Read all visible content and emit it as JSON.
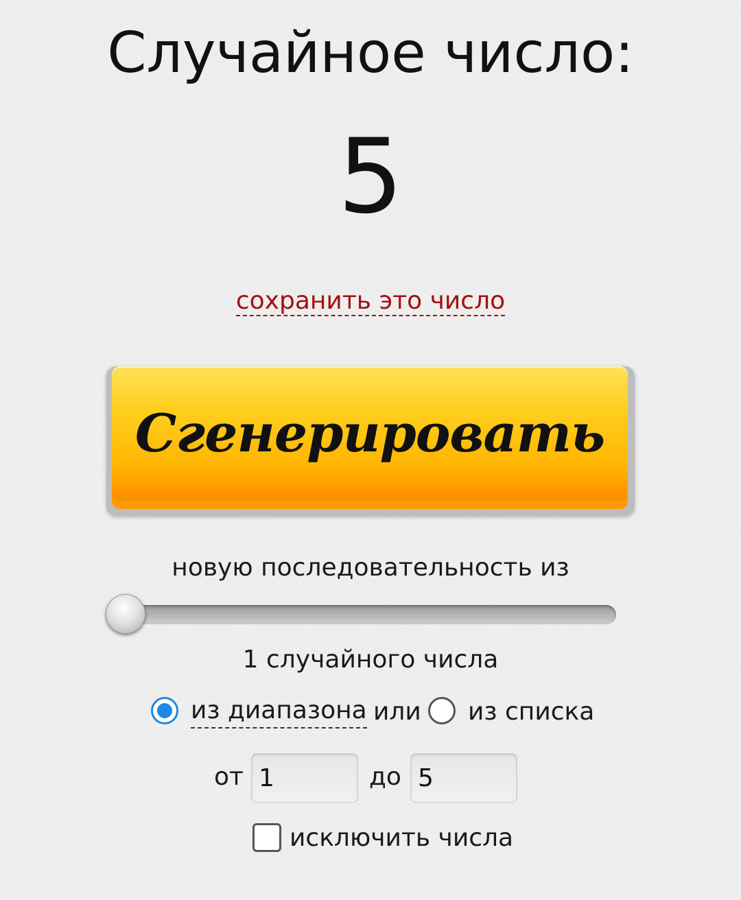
{
  "header": {
    "title": "Случайное число:"
  },
  "result": {
    "value": "5"
  },
  "save_link": {
    "label": "сохранить это число"
  },
  "generate_button": {
    "label": "Сгенерировать"
  },
  "sequence": {
    "label": "новую последовательность из",
    "slider_value": 1,
    "count_label": "1 случайного числа"
  },
  "mode": {
    "range_label": "из диапазона",
    "or_label": "или",
    "list_label": "из списка",
    "selected": "range"
  },
  "range": {
    "from_label": "от",
    "from_value": "1",
    "to_label": "до",
    "to_value": "5"
  },
  "exclude": {
    "label": "исключить числа",
    "checked": false
  },
  "colors": {
    "link": "#a51010",
    "accent_blue": "#1e88e5",
    "button_top": "#ffe25a",
    "button_bottom": "#ff9800"
  }
}
